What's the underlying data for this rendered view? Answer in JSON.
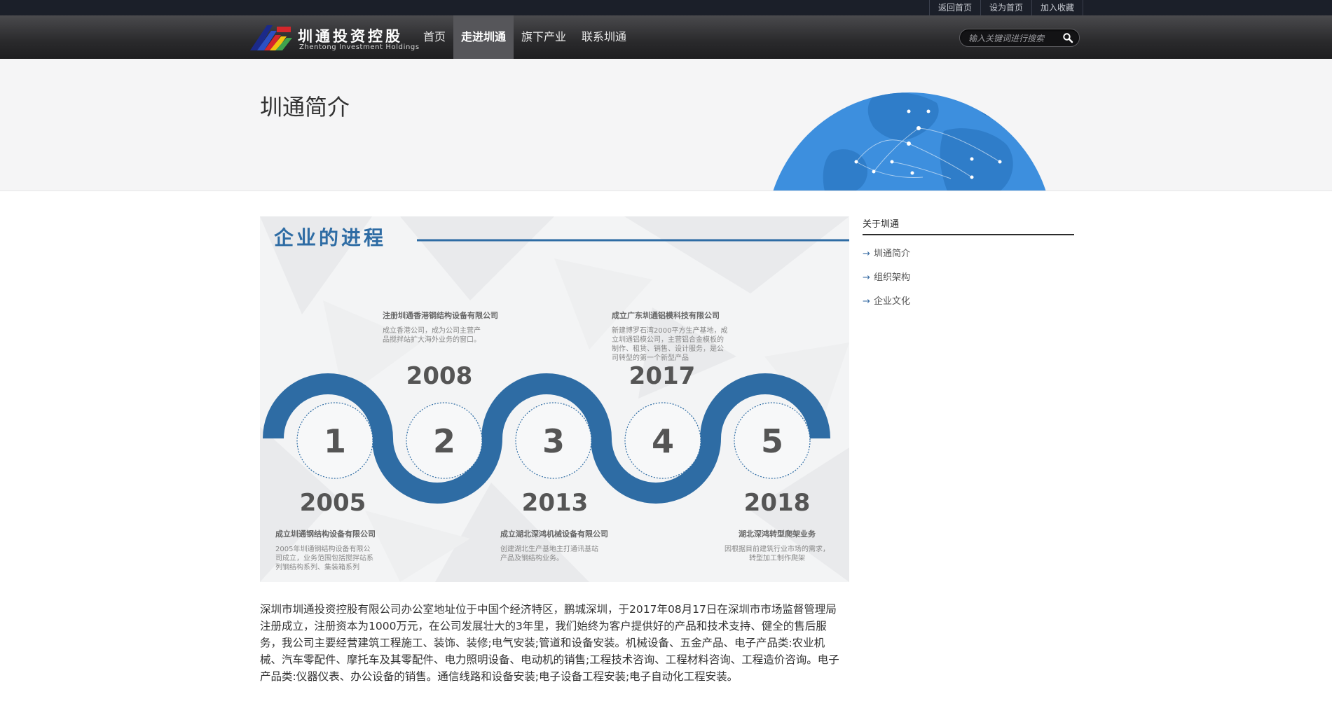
{
  "top_links": [
    "返回首页",
    "设为首页",
    "加入收藏"
  ],
  "logo": {
    "name_cn": "圳通投资控股",
    "name_en": "Zhentong Investment Holdings"
  },
  "nav": [
    "首页",
    "走进圳通",
    "旗下产业",
    "联系圳通"
  ],
  "nav_active": "走进圳通",
  "search": {
    "placeholder": "输入关键词进行搜索",
    "icon": "search-icon"
  },
  "banner": {
    "title": "圳通简介"
  },
  "timeline": {
    "heading": "企业的进程",
    "accent_color": "#2e6ca4",
    "milestones": [
      {
        "number": "1",
        "year": "2005",
        "title": "成立圳通钢结构设备有限公司",
        "lines": [
          "2005年圳通钢结构设备有限公",
          "司成立，业务范围包括搅拌站系",
          "列钢结构系列、集装箱系列"
        ]
      },
      {
        "number": "2",
        "year": "2008",
        "title": "注册圳通香港钢结构设备有限公司",
        "lines": [
          "成立香港公司，成为公司主营产",
          "品搅拌站扩大海外业务的窗口。"
        ]
      },
      {
        "number": "3",
        "year": "2013",
        "title": "成立湖北深鸿机械设备有限公司",
        "lines": [
          "创建湖北生产基地主打通讯基站",
          "产品及钢结构业务。"
        ]
      },
      {
        "number": "4",
        "year": "2017",
        "title": "成立广东圳通铝模科技有限公司",
        "lines": [
          "新建博罗石湾2000平方生产基地，成",
          "立圳通铝模公司，主营铝合金模板的",
          "制作、租赁、销售、设计服务，是公",
          "司转型的第一个新型产品"
        ]
      },
      {
        "number": "5",
        "year": "2018",
        "title": "湖北深鸿转型爬架业务",
        "lines": [
          "因根据目前建筑行业市场的需求，",
          "转型加工制作爬架"
        ]
      }
    ]
  },
  "intro": "深圳市圳通投资控股有限公司办公室地址位于中国个经济特区，鹏城深圳，于2017年08月17日在深圳市市场监督管理局注册成立，注册资本为1000万元，在公司发展壮大的3年里，我们始终为客户提供好的产品和技术支持、健全的售后服务，我公司主要经营建筑工程施工、装饰、装修;电气安装;管道和设备安装。机械设备、五金产品、电子产品类:农业机械、汽车零配件、摩托车及其零配件、电力照明设备、电动机的销售;工程技术咨询、工程材料咨询、工程造价咨询。电子产品类:仪器仪表、办公设备的销售。通信线路和设备安装;电子设备工程安装;电子自动化工程安装。",
  "sidebar": {
    "title": "关于圳通",
    "items": [
      "圳通简介",
      "组织架构",
      "企业文化"
    ]
  }
}
